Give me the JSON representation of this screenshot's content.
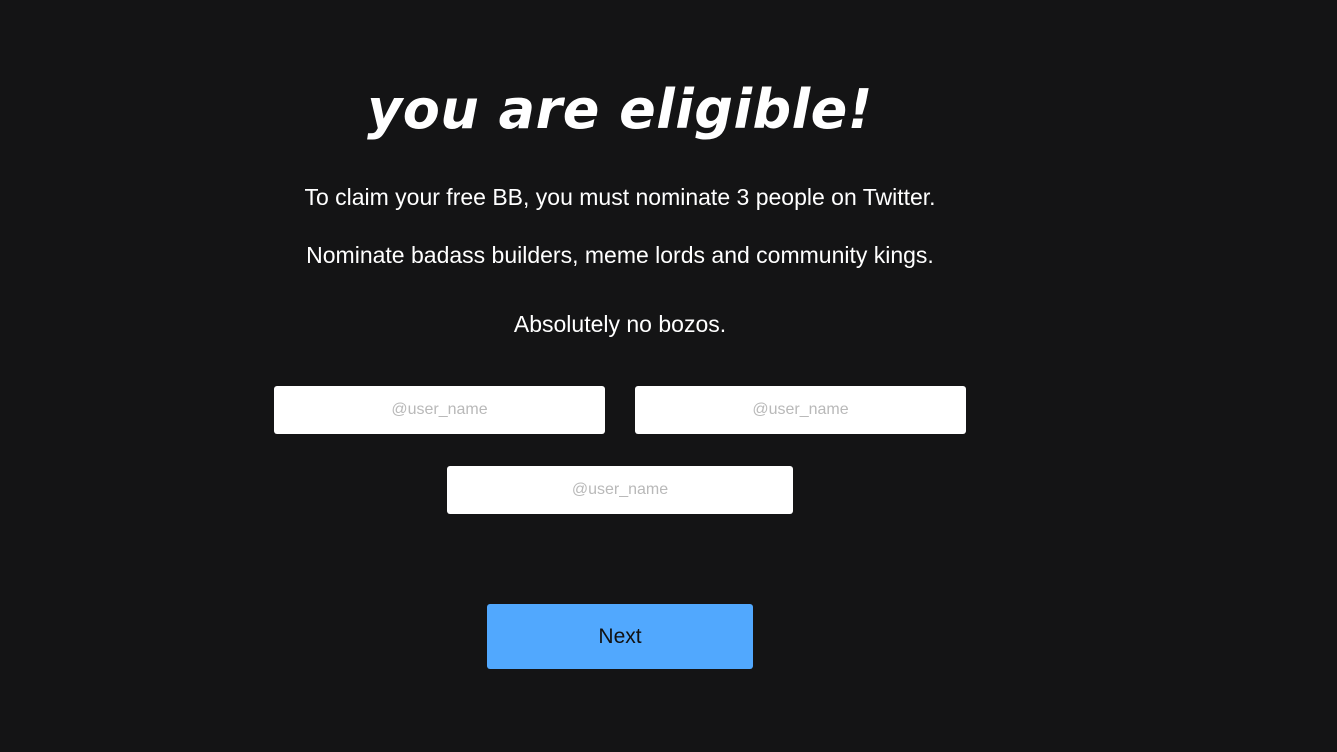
{
  "heading": "you are eligible!",
  "paragraphs": {
    "claim": "To claim your free BB, you must nominate 3 people on Twitter.",
    "nominate": "Nominate badass builders, meme lords and community kings.",
    "bozos": "Absolutely no bozos."
  },
  "form": {
    "nominee_1": {
      "value": "",
      "placeholder": "@user_name"
    },
    "nominee_2": {
      "value": "",
      "placeholder": "@user_name"
    },
    "nominee_3": {
      "value": "",
      "placeholder": "@user_name"
    }
  },
  "next_button": {
    "label": "Next"
  },
  "colors": {
    "background": "#141415",
    "text": "#ffffff",
    "button": "#51a8fe",
    "input_background": "#ffffff",
    "placeholder": "#b9b9b9"
  }
}
